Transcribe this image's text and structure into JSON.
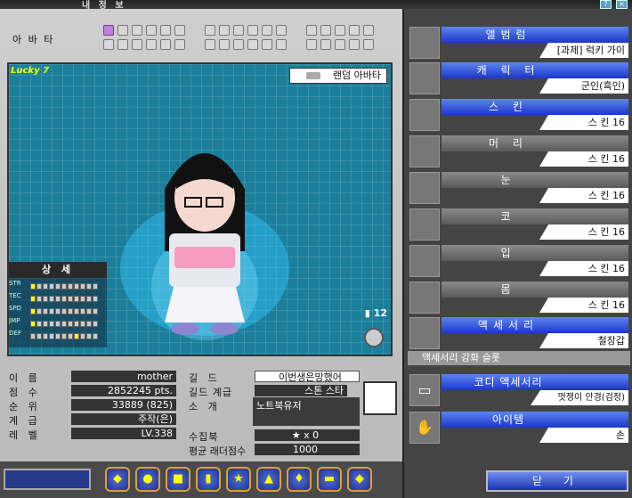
{
  "window": {
    "title": "내 정 보"
  },
  "avatar_row": {
    "label": "아 바 타"
  },
  "stage": {
    "random_avatar": "랜덤 아바타",
    "logo": "Lucky 7",
    "signal_count": "12"
  },
  "detail": {
    "title": "상 세",
    "stats": [
      {
        "name": "STR",
        "level": 0
      },
      {
        "name": "TEC",
        "level": 0
      },
      {
        "name": "SPD",
        "level": 0
      },
      {
        "name": "JMP",
        "level": 0
      },
      {
        "name": "DEF",
        "level": 7
      }
    ]
  },
  "profile": {
    "name_label": "이 름",
    "name": "mother",
    "score_label": "점 수",
    "score": "2852245 pts.",
    "rank_label": "순 위",
    "rank": "33889 (825)",
    "class_label": "계 급",
    "class": "주작(은)",
    "level_label": "레 벨",
    "level": "LV.338",
    "guild_label": "길 드",
    "guild": "이번생은망했어",
    "guild_rank_label": "길드 계급",
    "guild_rank": "스톤 스타",
    "intro_label": "소 개",
    "intro": "노트북유저",
    "collection_label": "수집북",
    "collection": "x 0",
    "ladder_label": "평균 래더점수",
    "ladder": "1000"
  },
  "right_items": [
    {
      "category": "앨범럼",
      "value": "[과제] 럭키 가이",
      "style": "blue",
      "icon": "lucky7-icon"
    },
    {
      "category": "캐 릭 터",
      "value": "군인(흑인)",
      "style": "blue",
      "icon": "character-icon"
    },
    {
      "category": "스  킨",
      "value": "스  킨 16",
      "style": "blue",
      "icon": "skin-icon"
    },
    {
      "category": "머 리",
      "value": "스  킨 16",
      "style": "gray",
      "icon": "hair-icon"
    },
    {
      "category": "눈",
      "value": "스  킨 16",
      "style": "gray",
      "icon": "eye-icon"
    },
    {
      "category": "코",
      "value": "스  킨 16",
      "style": "gray",
      "icon": "nose-icon"
    },
    {
      "category": "입",
      "value": "스  킨 16",
      "style": "gray",
      "icon": "mouth-icon"
    },
    {
      "category": "몸",
      "value": "스  킨 16",
      "style": "gray",
      "icon": "body-icon"
    },
    {
      "category": "액세서리",
      "value": "철장갑",
      "style": "blue",
      "icon": "accessory-icon"
    }
  ],
  "accessory_slot_label": "액세서리 강화 슬롯",
  "codi": {
    "category": "코디 액세서리",
    "value": "멋쟁이 안경(검정)"
  },
  "item": {
    "category": "아이템",
    "value": "손"
  },
  "close_label": "닫 기"
}
